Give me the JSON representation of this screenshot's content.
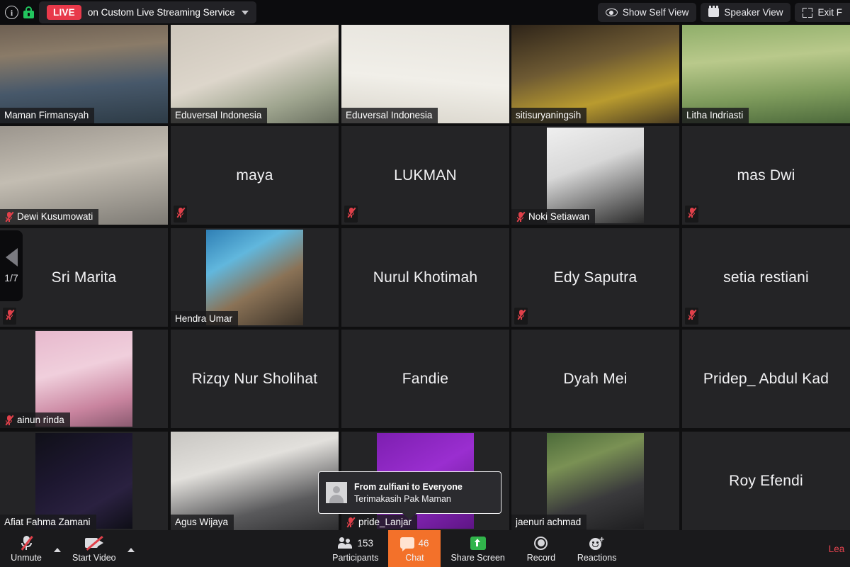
{
  "topbar": {
    "info_icon": "info-icon",
    "lock_icon": "lock-icon",
    "live_label": "LIVE",
    "stream_text": "on Custom Live Streaming Service",
    "self_view_label": "Show Self View",
    "self_view_icon": "eye-icon",
    "speaker_view_label": "Speaker View",
    "speaker_view_icon": "speaker-view-icon",
    "exit_fullscreen_label": "Exit F",
    "exit_fullscreen_icon": "exit-fullscreen-icon"
  },
  "navigation": {
    "prev_icon": "left-arrow-icon",
    "page_indicator": "1/7"
  },
  "chat_popup": {
    "from_line": "From zulfiani to Everyone",
    "message": "Terimakasih Pak Maman",
    "avatar_icon": "person-avatar-icon"
  },
  "grid": {
    "rows": 5,
    "cols": 5,
    "tiles": [
      {
        "name": "Maman Firmansyah",
        "display": "tag",
        "muted": false,
        "active": true,
        "media": "webcam-portrait"
      },
      {
        "name": "Eduversal Indonesia",
        "display": "tag",
        "muted": false,
        "active": false,
        "media": "webcam-logo-room"
      },
      {
        "name": "Eduversal Indonesia",
        "display": "tag",
        "muted": false,
        "active": false,
        "media": "webcam-logo-wall"
      },
      {
        "name": "sitisuryaningsih",
        "display": "tag",
        "muted": false,
        "active": false,
        "media": "webcam-hijab"
      },
      {
        "name": "Litha Indriasti",
        "display": "tag",
        "muted": false,
        "active": false,
        "media": "webcam-outdoor"
      },
      {
        "name": "Dewi Kusumowati",
        "display": "tag",
        "muted": true,
        "active": false,
        "media": "webcam-headphones"
      },
      {
        "name": "maya",
        "display": "center",
        "muted": true,
        "active": false,
        "media": "none"
      },
      {
        "name": "LUKMAN",
        "display": "center",
        "muted": true,
        "active": false,
        "media": "none"
      },
      {
        "name": "Noki Setiawan",
        "display": "tag",
        "muted": true,
        "active": false,
        "media": "photo-beatles"
      },
      {
        "name": "mas Dwi",
        "display": "center",
        "muted": true,
        "active": false,
        "media": "none"
      },
      {
        "name": "Sri Marita",
        "display": "center",
        "muted": true,
        "active": false,
        "media": "none"
      },
      {
        "name": "Hendra Umar",
        "display": "tag",
        "muted": false,
        "active": false,
        "media": "photo-group"
      },
      {
        "name": "Nurul Khotimah",
        "display": "center",
        "muted": false,
        "active": false,
        "media": "none"
      },
      {
        "name": "Edy Saputra",
        "display": "center",
        "muted": true,
        "active": false,
        "media": "none"
      },
      {
        "name": "setia restiani",
        "display": "center",
        "muted": true,
        "active": false,
        "media": "none"
      },
      {
        "name": "ainun rinda",
        "display": "tag",
        "muted": true,
        "active": false,
        "media": "photo-child"
      },
      {
        "name": "Rizqy Nur Sholihat",
        "display": "center",
        "muted": false,
        "active": false,
        "media": "none"
      },
      {
        "name": "Fandie",
        "display": "center",
        "muted": false,
        "active": false,
        "media": "none"
      },
      {
        "name": "Dyah Mei",
        "display": "center",
        "muted": false,
        "active": false,
        "media": "none"
      },
      {
        "name": "Pridep_ Abdul Kad",
        "display": "center",
        "muted": false,
        "active": false,
        "media": "none"
      },
      {
        "name": "Afiat Fahma Zamani",
        "display": "tag",
        "muted": false,
        "active": false,
        "media": "photo-calligraphy"
      },
      {
        "name": "Agus Wijaya",
        "display": "tag",
        "muted": false,
        "active": false,
        "media": "webcam-suit"
      },
      {
        "name": "pride_Lanjar",
        "display": "tag",
        "muted": true,
        "active": false,
        "media": "photo-purple"
      },
      {
        "name": "jaenuri achmad",
        "display": "tag",
        "muted": false,
        "active": false,
        "media": "photo-man-outdoor"
      },
      {
        "name": "Roy Efendi",
        "display": "center",
        "muted": false,
        "active": false,
        "media": "none"
      }
    ]
  },
  "toolbar": {
    "mute_label": "Unmute",
    "mute_icon": "microphone-muted-icon",
    "mute_chevron_icon": "chevron-up-icon",
    "video_label": "Start Video",
    "video_icon": "camera-off-icon",
    "video_chevron_icon": "chevron-up-icon",
    "participants_label": "Participants",
    "participants_icon": "people-icon",
    "participants_count": "153",
    "chat_label": "Chat",
    "chat_icon": "chat-bubble-icon",
    "chat_count": "46",
    "share_label": "Share Screen",
    "share_icon": "share-screen-icon",
    "record_label": "Record",
    "record_icon": "record-circle-icon",
    "reactions_label": "Reactions",
    "reactions_icon": "reactions-smiley-icon",
    "leave_label": "Lea"
  },
  "colors": {
    "accent_orange": "#f3712a",
    "live_red": "#e8394a",
    "leave_red": "#e8444f",
    "active_border": "#b5e356",
    "share_green": "#31b44b",
    "tile_bg": "#242426",
    "app_bg": "#0f0f10"
  }
}
